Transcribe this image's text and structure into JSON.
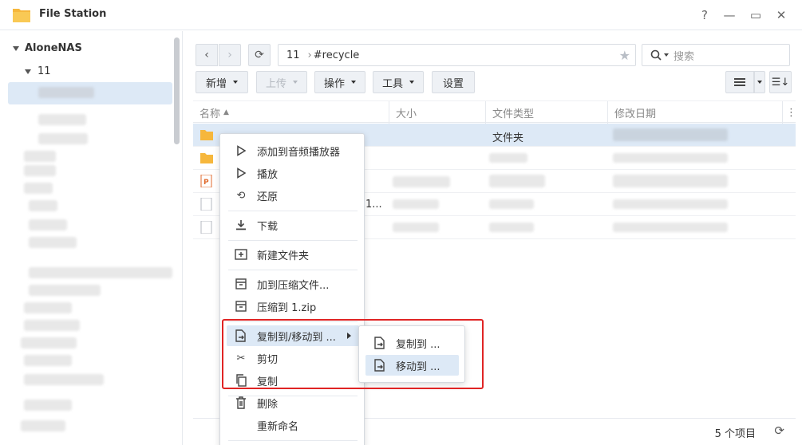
{
  "window": {
    "title": "File Station",
    "help_symbol": "?",
    "minimize_symbol": "—",
    "maximize_symbol": "▭",
    "close_symbol": "✕"
  },
  "sidebar": {
    "root_label": "AloneNAS",
    "folder_label": "11"
  },
  "toolbar": {
    "path_segments": [
      "11",
      "#recycle"
    ],
    "path_separator": "›",
    "search_placeholder": "搜索",
    "buttons": {
      "create": "新增",
      "upload": "上传",
      "action": "操作",
      "tools": "工具",
      "settings": "设置"
    }
  },
  "table": {
    "columns": [
      "名称",
      "大小",
      "文件类型",
      "修改日期"
    ],
    "row0_type": "文件夹",
    "row3_partial": "1...",
    "status": "5 个项目"
  },
  "context_menu": {
    "items": [
      "添加到音频播放器",
      "播放",
      "还原",
      "下载",
      "新建文件夹",
      "加到压缩文件...",
      "压缩到 1.zip",
      "复制到/移动到 ...",
      "剪切",
      "复制",
      "删除",
      "重新命名"
    ],
    "submenu": [
      "复制到 ...",
      "移动到 ..."
    ]
  },
  "colors": {
    "accent_selection": "#dde9f6",
    "highlight_box": "#e02424",
    "folder": "#f6b73c"
  }
}
